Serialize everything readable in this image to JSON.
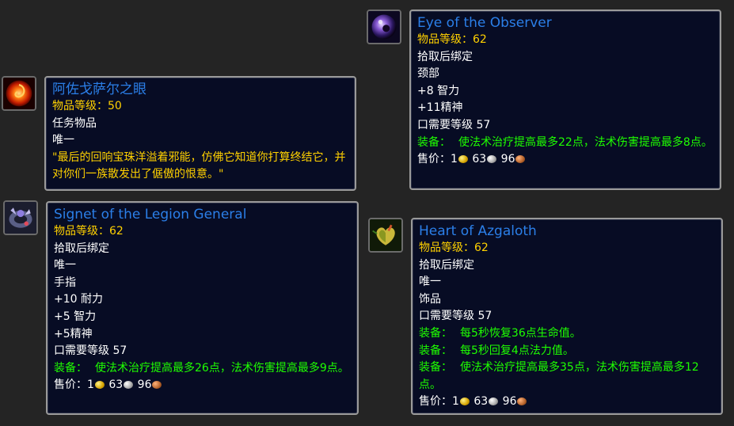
{
  "items": [
    {
      "id": "eye_of_azsharah",
      "name": "阿佐戈萨尔之眼",
      "item_level": "物品等级：50",
      "lines": [
        "任务物品",
        "唯一"
      ],
      "flavor": "\"最后的回响宝珠洋溢着邪能，仿佛它知道你打算终结它，并对你们一族散发出了倨傲的恨意。\"",
      "icon": "fire-orb-icon"
    },
    {
      "id": "signet",
      "name": "Signet of the Legion General",
      "item_level": "物品等级：62",
      "lines": [
        "拾取后绑定",
        "唯一",
        "手指",
        "+10 耐力",
        "+5 智力",
        "+5精神",
        "口需要等级 57"
      ],
      "equip": [
        {
          "label": "装备：",
          "text": "使法术治疗提高最多26点，法术伤害提高最多9点。"
        }
      ],
      "sell": {
        "label": "售价：",
        "gold": "1",
        "silver": "63",
        "copper": "96"
      },
      "icon": "signet-ring-icon"
    },
    {
      "id": "eye_observer",
      "name": "Eye of the Observer",
      "item_level": "物品等级：62",
      "lines": [
        "拾取后绑定",
        "颈部",
        "+8 智力",
        "+11精神",
        "口需要等级 57"
      ],
      "equip": [
        {
          "label": "装备：",
          "text": "使法术治疗提高最多22点，法术伤害提高最多8点。"
        }
      ],
      "sell": {
        "label": "售价：",
        "gold": "1",
        "silver": "63",
        "copper": "96"
      },
      "icon": "purple-eye-icon"
    },
    {
      "id": "heart_azgaloth",
      "name": "Heart of Azgaloth",
      "item_level": "物品等级：62",
      "lines": [
        "拾取后绑定",
        "唯一",
        "饰品",
        "口需要等级 57"
      ],
      "equip": [
        {
          "label": "装备：",
          "text": "每5秒恢复36点生命值。"
        },
        {
          "label": "装备：",
          "text": "每5秒回复4点法力值。"
        },
        {
          "label": "装备：",
          "text": "使法术治疗提高最多35点，法术伤害提高最多12点。"
        }
      ],
      "sell": {
        "label": "售价：",
        "gold": "1",
        "silver": "63",
        "copper": "96"
      },
      "icon": "demon-heart-icon"
    }
  ],
  "colors": {
    "title": "#2b7fe8",
    "item_level": "#ffd100",
    "equip": "#1eff00",
    "background": "#242424",
    "tooltip_bg": "#070c24"
  }
}
